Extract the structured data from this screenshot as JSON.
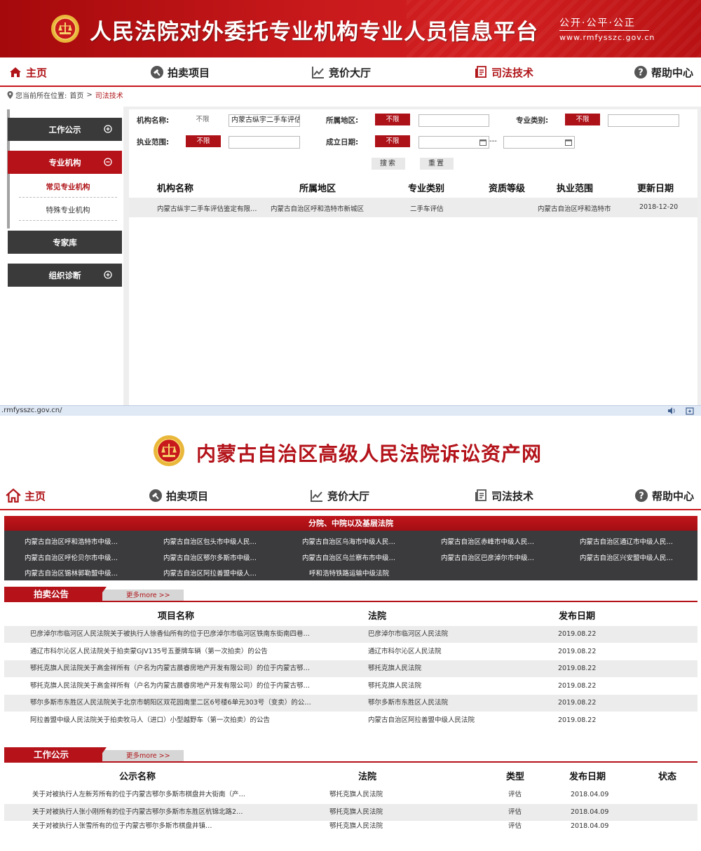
{
  "banner": {
    "title": "人民法院对外委托专业机构专业人员信息平台",
    "slogan": "公开·公平·公正",
    "url": "www.rmfysszc.gov.cn"
  },
  "nav_top": [
    {
      "label": "主页",
      "icon": "home-icon",
      "active": true
    },
    {
      "label": "拍卖项目",
      "icon": "gavel-icon"
    },
    {
      "label": "竞价大厅",
      "icon": "trend-chart-icon"
    },
    {
      "label": "司法技术",
      "icon": "document-icon",
      "active": true
    },
    {
      "label": "帮助中心",
      "icon": "help-icon"
    }
  ],
  "breadcrumb": {
    "prefix": "您当前所在位置:",
    "home": "首页",
    "sep": ">",
    "current": "司法技术"
  },
  "sidebar": {
    "work_public": "工作公示",
    "pro_org": "专业机构",
    "sub_common": "常见专业机构",
    "sub_special": "特殊专业机构",
    "expert_db": "专家库",
    "org_diag": "组织诊断"
  },
  "filter": {
    "org_name_label": "机构名称:",
    "org_name_tag": "不限",
    "org_name_value": "内蒙古纵宇二手车评估",
    "region_label": "所属地区:",
    "region_tag": "不限",
    "category_label": "专业类别:",
    "category_tag": "不限",
    "scope_label": "执业范围:",
    "scope_tag": "不限",
    "date_label": "成立日期:",
    "date_tag": "不限",
    "date_sep": "---",
    "search": "搜索",
    "reset": "重置"
  },
  "org_table": {
    "headers": [
      "机构名称",
      "所属地区",
      "专业类别",
      "资质等级",
      "执业范围",
      "更新日期"
    ],
    "rows": [
      [
        "内蒙古纵宇二手车评估鉴定有限…",
        "内蒙古自治区呼和浩特市新城区",
        "二手车评估",
        "",
        "内蒙古自治区呼和浩特市",
        "2018-12-20"
      ]
    ]
  },
  "status_bar": {
    "url": ".rmfysszc.gov.cn/"
  },
  "site2": {
    "title": "内蒙古自治区高级人民法院诉讼资产网"
  },
  "nav_bottom": [
    {
      "label": "主页",
      "icon": "home-icon",
      "active": true
    },
    {
      "label": "拍卖项目",
      "icon": "gavel-icon"
    },
    {
      "label": "竞价大厅",
      "icon": "trend-chart-icon"
    },
    {
      "label": "司法技术",
      "icon": "document-icon"
    },
    {
      "label": "帮助中心",
      "icon": "help-icon"
    }
  ],
  "branches": {
    "title": "分院、中院以及基层法院",
    "items": [
      "内蒙古自治区呼和浩特市中级…",
      "内蒙古自治区包头市中级人民…",
      "内蒙古自治区乌海市中级人民…",
      "内蒙古自治区赤峰市中级人民…",
      "内蒙古自治区通辽市中级人民…",
      "内蒙古自治区呼伦贝尔市中级…",
      "内蒙古自治区鄂尔多斯市中级…",
      "内蒙古自治区乌兰察布市中级…",
      "内蒙古自治区巴彦淖尔市中级…",
      "内蒙古自治区兴安盟中级人民…",
      "内蒙古自治区锡林郭勒盟中级…",
      "内蒙古自治区阿拉善盟中级人…",
      "呼和浩特铁路运输中级法院"
    ]
  },
  "auction": {
    "tab": "拍卖公告",
    "more": "更多more >>",
    "headers": [
      "项目名称",
      "法院",
      "发布日期"
    ],
    "rows": [
      [
        "巴彦淖尔市临河区人民法院关于被执行人徐香仙所有的位于巴彦淖尔市临河区铁南东街南四巷…",
        "巴彦淖尔市临河区人民法院",
        "2019.08.22"
      ],
      [
        "通辽市科尔沁区人民法院关于拍卖蒙GJV135号五菱牌车辆（第一次拍卖）的公告",
        "通辽市科尔沁区人民法院",
        "2019.08.22"
      ],
      [
        "鄂托克旗人民法院关于高金祥所有（户名为内蒙古晨睿房地产开发有限公司）的位于内蒙古鄂…",
        "鄂托克旗人民法院",
        "2019.08.22"
      ],
      [
        "鄂托克旗人民法院关于高金祥所有（户名为内蒙古晨睿房地产开发有限公司）的位于内蒙古鄂…",
        "鄂托克旗人民法院",
        "2019.08.22"
      ],
      [
        "鄂尔多斯市东胜区人民法院关于北京市朝阳区双花园南里二区6号楼6单元303号（变卖）的公…",
        "鄂尔多斯市东胜区人民法院",
        "2019.08.22"
      ],
      [
        "阿拉善盟中级人民法院关于拍卖牧马人（进口）小型越野车（第一次拍卖）的公告",
        "内蒙古自治区阿拉善盟中级人民法院",
        "2019.08.22"
      ]
    ]
  },
  "work": {
    "tab": "工作公示",
    "more": "更多more >>",
    "headers": [
      "公示名称",
      "法院",
      "类型",
      "发布日期",
      "状态"
    ],
    "rows": [
      [
        "关于对被执行人左新芳所有的位于内蒙古鄂尔多斯市棋盘井大街南（产…",
        "鄂托克旗人民法院",
        "评估",
        "2018.04.09",
        ""
      ],
      [
        "关于对被执行人张小刚所有的位于内蒙古鄂尔多斯市东胜区杭锦北路2…",
        "鄂托克旗人民法院",
        "评估",
        "2018.04.09",
        ""
      ],
      [
        "关于对被执行人张雪所有的位于内蒙古鄂尔多斯市棋盘井镇…",
        "鄂托克旗人民法院",
        "评估",
        "2018.04.09",
        ""
      ]
    ]
  },
  "colors": {
    "brand_red": "#b5121a",
    "dark": "#3a3a3a"
  }
}
